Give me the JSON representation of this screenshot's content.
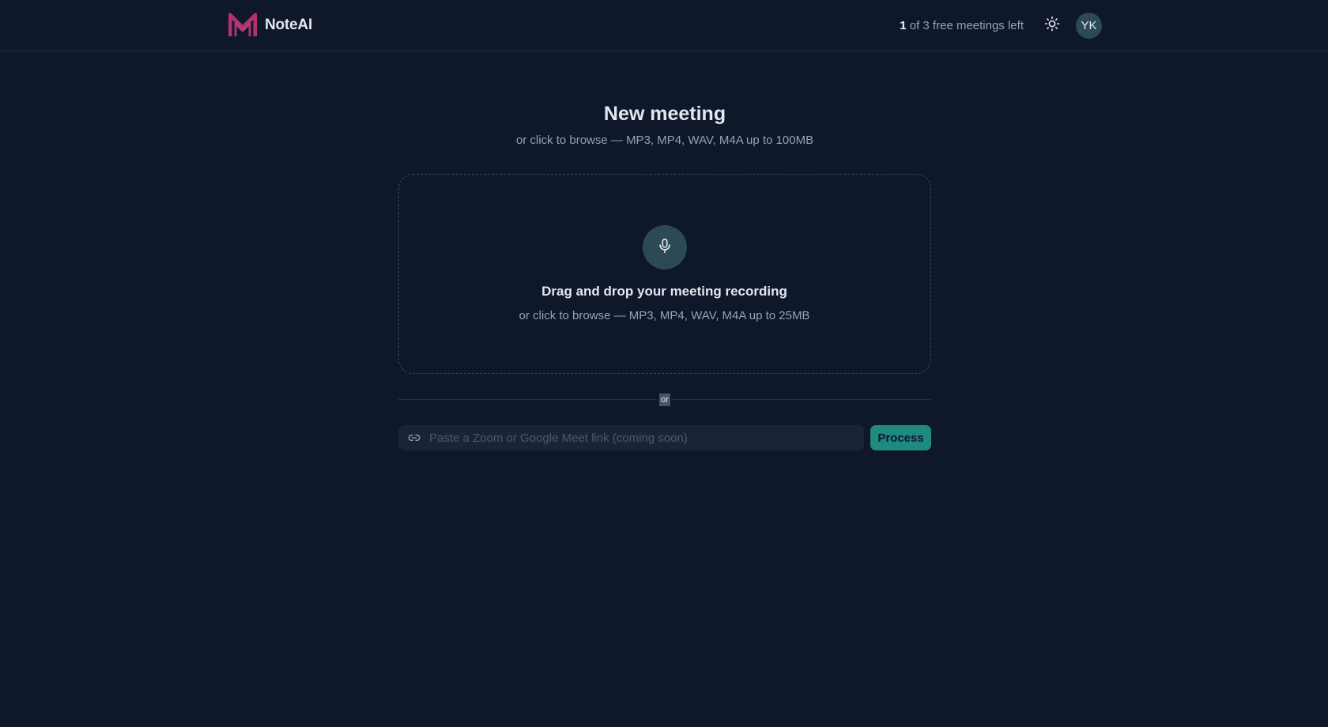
{
  "brand": {
    "name": "NoteAI",
    "logo_icon": "m-logo-icon",
    "logo_color": "#b4306e"
  },
  "header": {
    "quota_count": "1",
    "quota_text": " of 3 free meetings left",
    "theme_icon": "sun-icon",
    "avatar_initials": "YK"
  },
  "main": {
    "title": "New meeting",
    "subtitle": "or click to browse — MP3, MP4, WAV, M4A up to 100MB"
  },
  "dropzone": {
    "icon": "microphone-icon",
    "title": "Drag and drop your meeting recording",
    "subtitle": "or click to browse — MP3, MP4, WAV, M4A up to 25MB"
  },
  "divider": {
    "label": "or"
  },
  "link_form": {
    "icon": "link-icon",
    "value": "",
    "placeholder": "Paste a Zoom or Google Meet link (coming soon)",
    "button_label": "Process"
  },
  "colors": {
    "background": "#0f172a",
    "accent": "#1f8a80",
    "icon_circle": "#2c4a56",
    "brand": "#b4306e"
  }
}
